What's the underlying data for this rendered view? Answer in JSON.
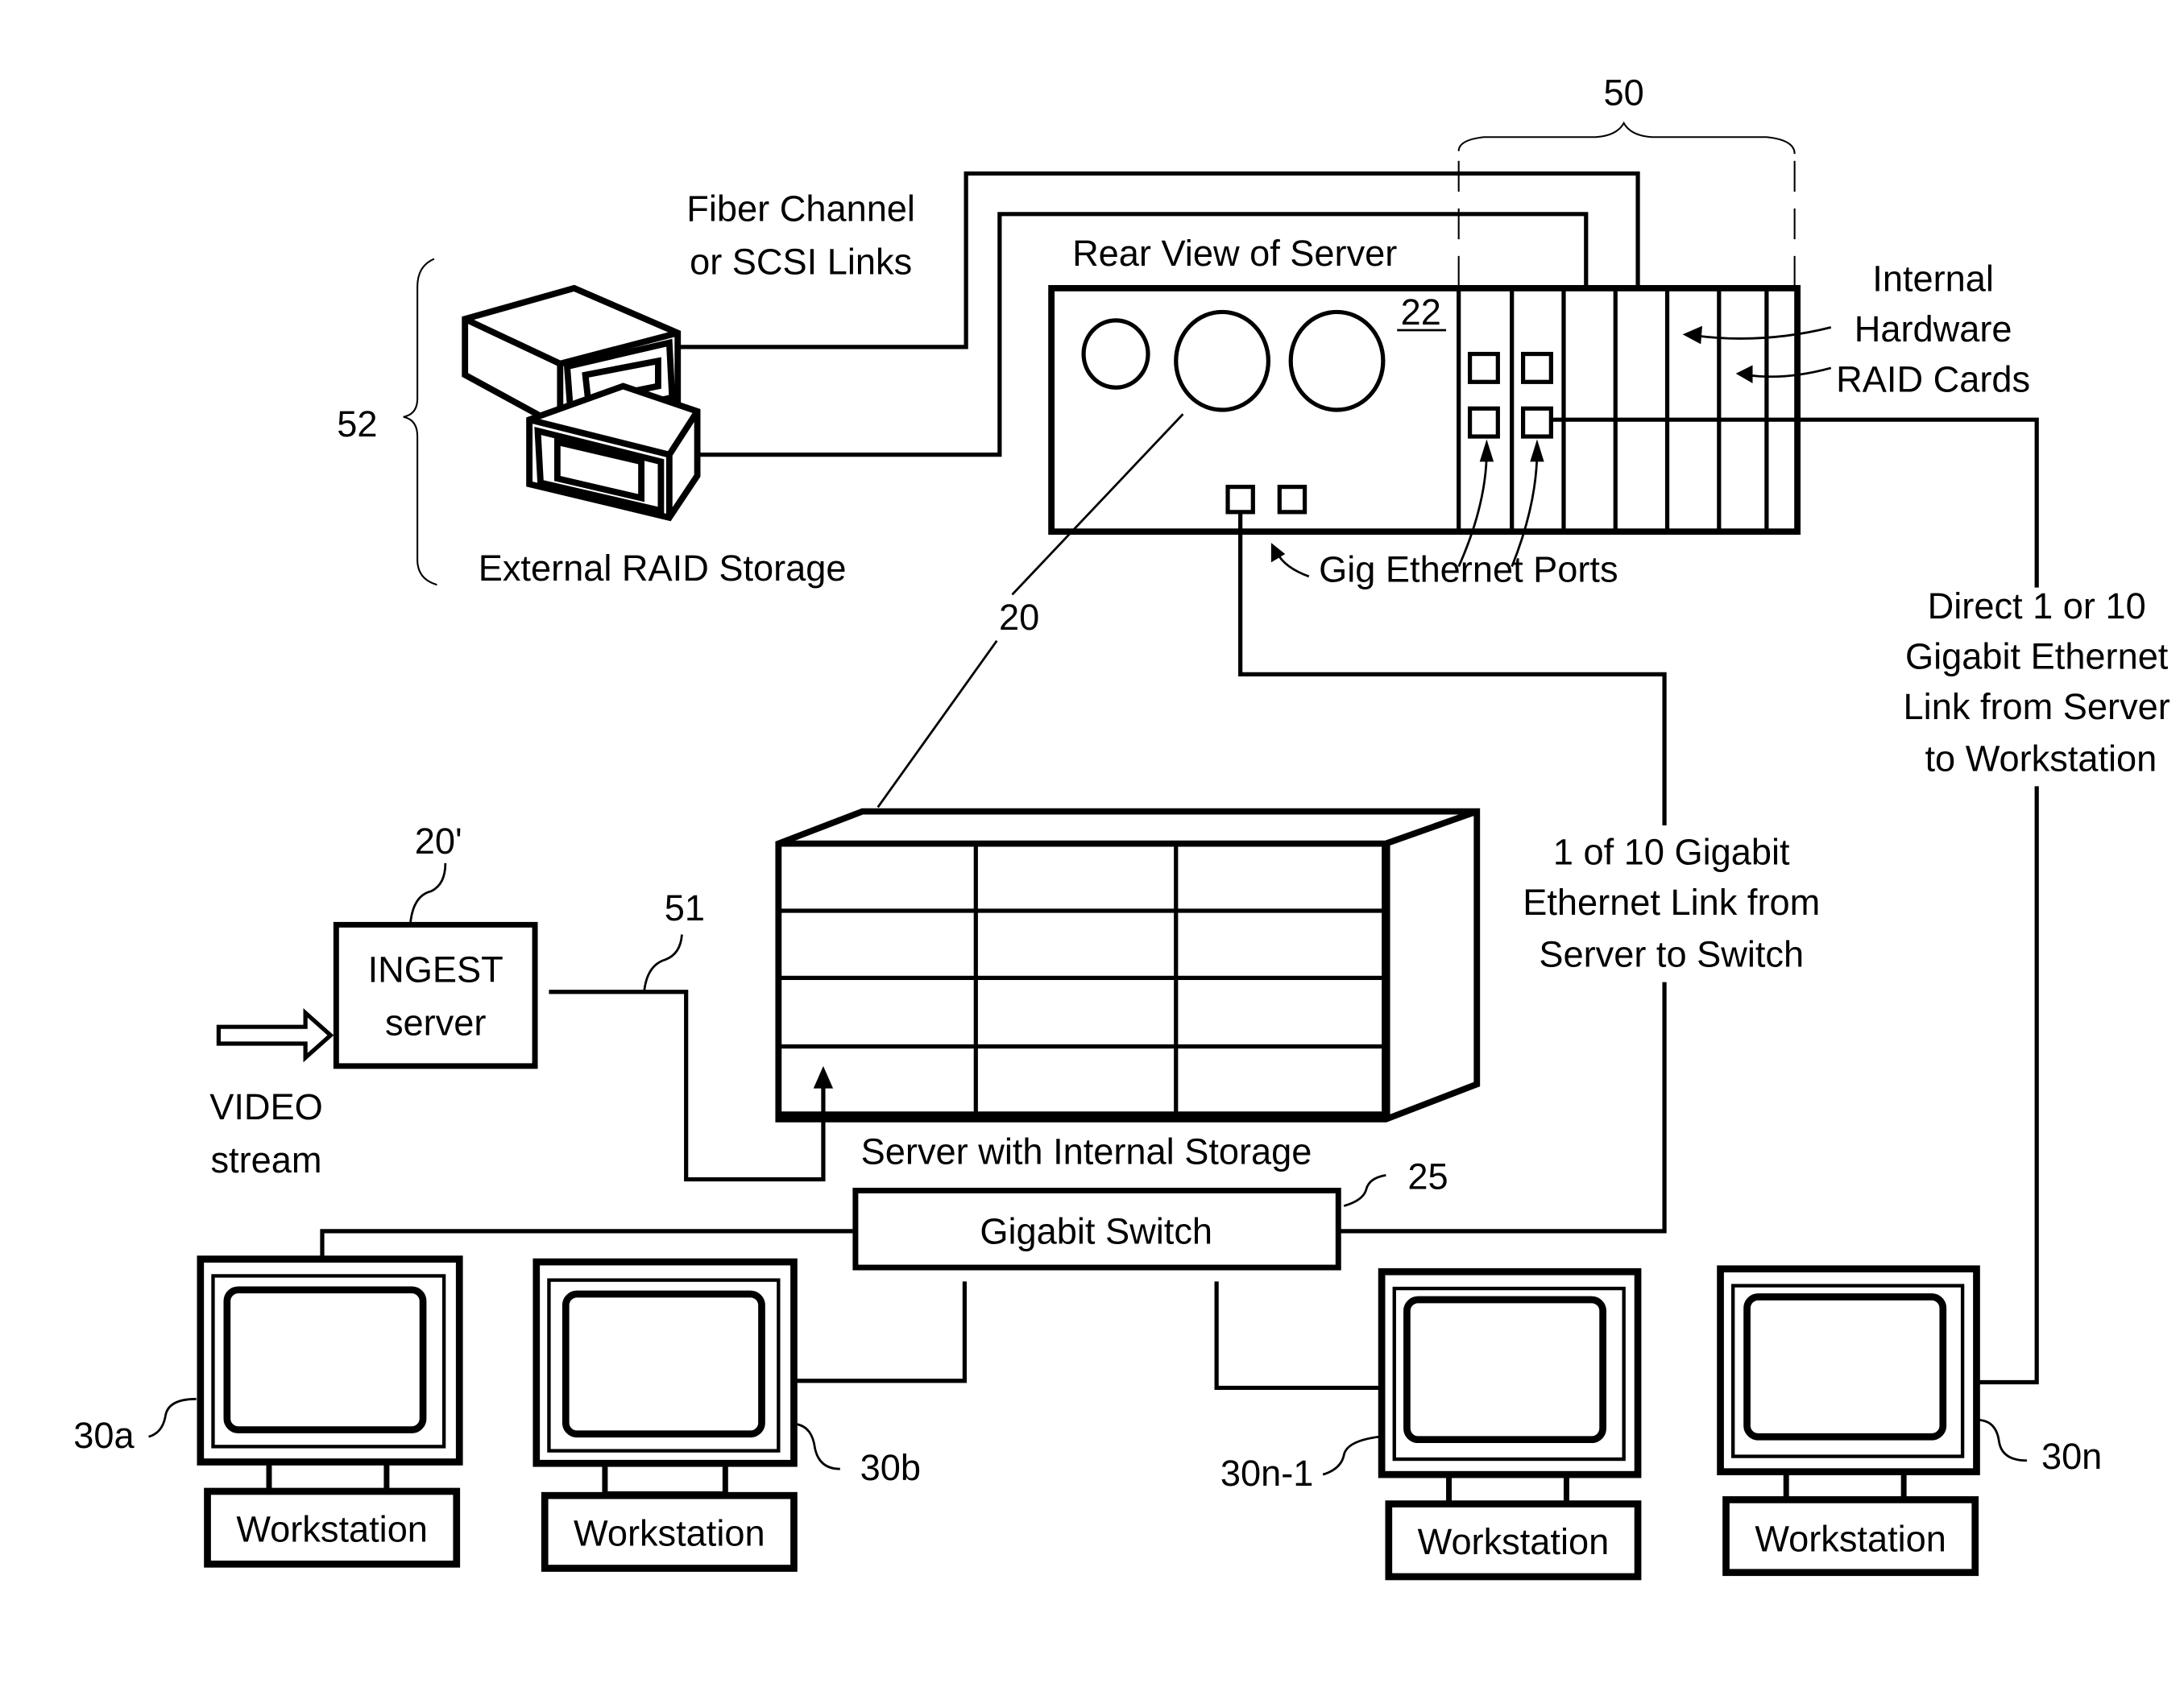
{
  "figure": {
    "labels": {
      "fiber_channel_line1": "Fiber Channel",
      "fiber_channel_line2": "or SCSI Links",
      "rear_view": "Rear View of Server",
      "internal_line1": "Internal",
      "internal_line2": "Hardware",
      "internal_line3": "RAID Cards",
      "external_raid": "External RAID Storage",
      "gig_ports": "Gig Ethernet Ports",
      "direct_line1": "Direct 1 or 10",
      "direct_line2": "Gigabit Ethernet",
      "direct_line3": "Link from Server",
      "direct_line4": "to Workstation",
      "switch_link_line1": "1 of 10 Gigabit",
      "switch_link_line2": "Ethernet Link from",
      "switch_link_line3": "Server to Switch",
      "ingest_line1": "INGEST",
      "ingest_line2": "server",
      "video_line1": "VIDEO",
      "video_line2": "stream",
      "server_internal": "Server with Internal Storage",
      "gigabit_switch": "Gigabit Switch"
    },
    "refs": {
      "r50": "50",
      "r52": "52",
      "r22": "22",
      "r20": "20",
      "r20p": "20'",
      "r51": "51",
      "r25": "25",
      "r30a": "30a",
      "r30b": "30b",
      "r30n1": "30n-1",
      "r30n": "30n"
    },
    "workstations": [
      {
        "ref": "30a",
        "label": "Workstation"
      },
      {
        "ref": "30b",
        "label": "Workstation"
      },
      {
        "ref": "30n-1",
        "label": "Workstation"
      },
      {
        "ref": "30n",
        "label": "Workstation"
      }
    ]
  }
}
